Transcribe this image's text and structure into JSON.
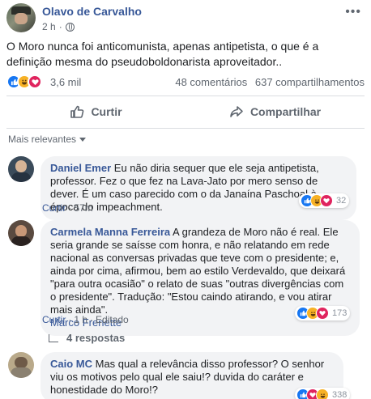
{
  "post": {
    "author": "Olavo de Carvalho",
    "time": "2 h",
    "text": "O Moro nunca foi anticomunista, apenas antipetista, o que é a definição mesma do pseudoboldonarista aproveitador..",
    "reactions_count": "3,6 mil",
    "comments_count": "48 comentários",
    "shares_count": "637 compartilhamentos"
  },
  "actions": {
    "like_label": "Curtir",
    "share_label": "Compartilhar"
  },
  "comments_sort": "Mais relevantes",
  "comments": [
    {
      "author": "Daniel Emer",
      "text": "Eu não diria sequer que ele seja antipetista, professor. Fez o que fez na Lava-Jato por mero senso de dever. É um caso parecido com o da Janaína Paschoal à época do impeachment.",
      "reactions_count": "32",
      "like_link": "Curtir",
      "time": "57m"
    },
    {
      "author": "Carmela Manna Ferreira",
      "text": "A grandeza de Moro não é real. Ele seria grande se saísse com honra, e não relatando em rede nacional as conversas privadas que teve com o presidente; e, ainda por cima, afirmou, bem ao estilo Verdevaldo, que deixará \"para outra ocasião\" o relato de suas \"outras divergências com o presidente\". Tradução: \"Estou caindo atirando, e vou atirar mais ainda\".",
      "mention": "Marco Frenette",
      "reactions_count": "173",
      "like_link": "Curtir",
      "time": "1 h",
      "edited": "Editado",
      "replies": "4 respostas"
    },
    {
      "author": "Caio MC",
      "text": "Mas qual a relevância disso professor? O senhor viu os motivos pelo qual ele saiu!? duvida do caráter e honestidade do Moro!?",
      "reactions_count": "338"
    }
  ],
  "colors": {
    "link": "#385898",
    "like": "#1877f2",
    "haha": "#f7b125",
    "love": "#e0245e",
    "bubble": "#f2f3f5"
  }
}
